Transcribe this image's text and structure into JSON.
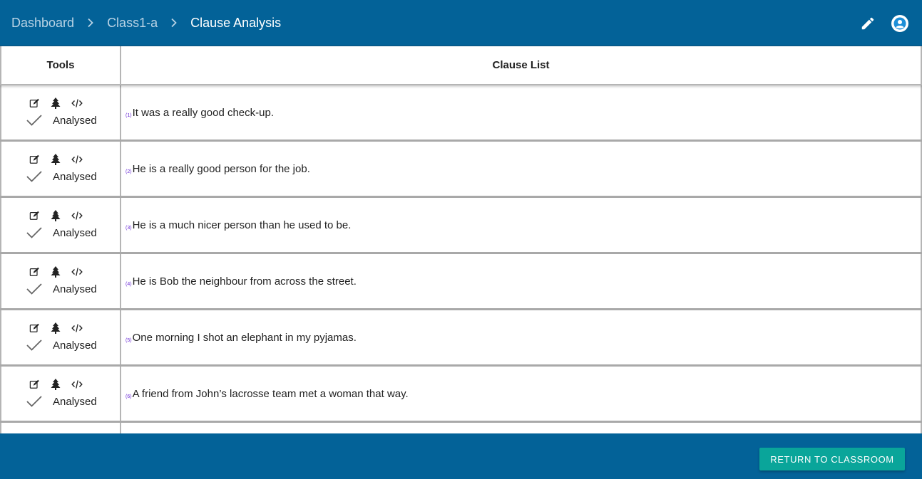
{
  "breadcrumb": {
    "items": [
      "Dashboard",
      "Class1-a",
      "Clause Analysis"
    ]
  },
  "header": {
    "icons": [
      "pencil-icon",
      "account-circle-icon"
    ]
  },
  "table": {
    "columns": [
      "Tools",
      "Clause List"
    ],
    "rows": [
      {
        "num": "(1)",
        "text": "It was a really good check-up.",
        "status": "Analysed"
      },
      {
        "num": "(2)",
        "text": "He is a really good person for the job.",
        "status": "Analysed"
      },
      {
        "num": "(3)",
        "text": "He is a much nicer person than he used to be.",
        "status": "Analysed"
      },
      {
        "num": "(4)",
        "text": "He is Bob the neighbour from across the street.",
        "status": "Analysed"
      },
      {
        "num": "(5)",
        "text": "One morning I shot an elephant in my pyjamas.",
        "status": "Analysed"
      },
      {
        "num": "(6)",
        "text": "A friend from John’s lacrosse team met a woman that way.",
        "status": "Analysed"
      },
      {
        "num": "",
        "text": "",
        "status": ""
      }
    ],
    "row_icons": [
      "edit-icon",
      "tree-icon",
      "code-icon",
      "check-icon"
    ]
  },
  "footer": {
    "return_label": "RETURN TO CLASSROOM"
  },
  "colors": {
    "primary": "#036298",
    "accent": "#0aa59a",
    "number": "#6a2bd6"
  }
}
